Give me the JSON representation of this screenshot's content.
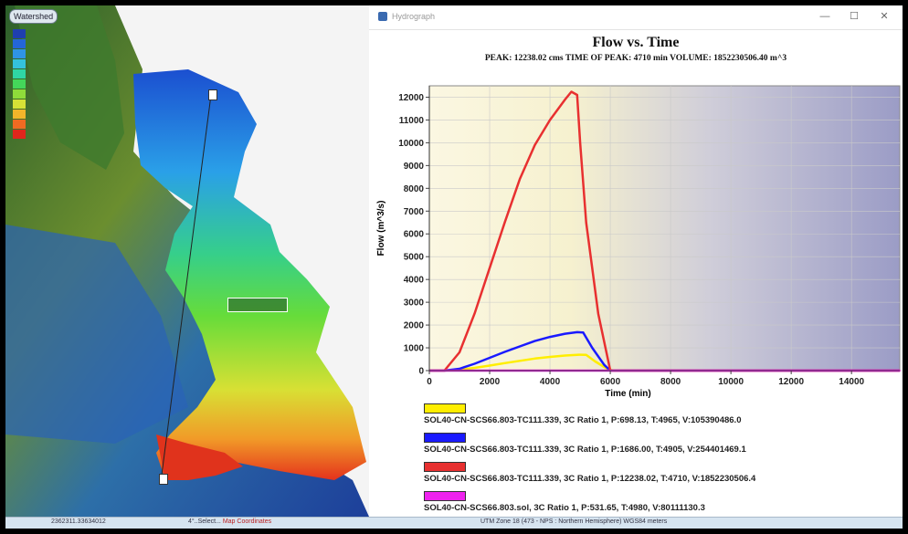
{
  "map": {
    "title": "Watershed",
    "legend": [
      {
        "label": "",
        "color": "#1f3fb0"
      },
      {
        "label": "",
        "color": "#2466d8"
      },
      {
        "label": "",
        "color": "#2f94e6"
      },
      {
        "label": "",
        "color": "#34c2dc"
      },
      {
        "label": "",
        "color": "#2fd6a4"
      },
      {
        "label": "",
        "color": "#44d65a"
      },
      {
        "label": "",
        "color": "#8fdc3a"
      },
      {
        "label": "",
        "color": "#d6e236"
      },
      {
        "label": "",
        "color": "#f2b52a"
      },
      {
        "label": "",
        "color": "#ef6a22"
      },
      {
        "label": "",
        "color": "#e0261c"
      }
    ],
    "basin_label": "",
    "markers": [
      {
        "label": ""
      },
      {
        "label": ""
      }
    ]
  },
  "window": {
    "title": "Hydrograph",
    "minimize": "—",
    "maximize": "☐",
    "close": "✕"
  },
  "chart_data": {
    "type": "line",
    "title": "Flow vs. Time",
    "subtitle": "PEAK: 12238.02 cms   TIME OF PEAK: 4710 min   VOLUME: 1852230506.40 m^3",
    "xlabel": "Time (min)",
    "ylabel": "Flow (m^3/s)",
    "xlim": [
      0,
      15600
    ],
    "ylim": [
      0,
      12500
    ],
    "xticks": [
      0,
      2000,
      4000,
      6000,
      8000,
      10000,
      12000,
      14000
    ],
    "yticks": [
      0,
      1000,
      2000,
      3000,
      4000,
      5000,
      6000,
      7000,
      8000,
      9000,
      10000,
      11000,
      12000
    ],
    "series": [
      {
        "name": "SOL40-CN-SCS66.803-TC111.339, 3C Ratio 1, P:698.13, T:4965, V:105390486.0",
        "color": "#ffee00",
        "x": [
          0,
          500,
          1000,
          1500,
          2000,
          2500,
          3000,
          3500,
          4000,
          4500,
          4965,
          5200,
          5500,
          5900,
          6100,
          15600
        ],
        "y": [
          0,
          0,
          40,
          120,
          220,
          330,
          430,
          530,
          600,
          660,
          698,
          690,
          400,
          80,
          0,
          0
        ]
      },
      {
        "name": "SOL40-CN-SCS66.803-TC111.339, 3C Ratio 1, P:1686.00, T:4905, V:254401469.1",
        "color": "#1a1aff",
        "x": [
          0,
          500,
          1000,
          1500,
          2000,
          2500,
          3000,
          3500,
          4000,
          4500,
          4905,
          5100,
          5400,
          5800,
          6000,
          15600
        ],
        "y": [
          0,
          0,
          80,
          300,
          560,
          820,
          1060,
          1300,
          1480,
          1620,
          1686,
          1670,
          1000,
          250,
          0,
          0
        ]
      },
      {
        "name": "SOL40-CN-SCS66.803-TC111.339, 3C Ratio 1, P:12238.02, T:4710, V:1852230506.4",
        "color": "#e83030",
        "x": [
          0,
          500,
          1000,
          1500,
          2000,
          2500,
          3000,
          3500,
          4000,
          4500,
          4710,
          4900,
          5000,
          5200,
          5600,
          6000,
          15600
        ],
        "y": [
          0,
          0,
          800,
          2500,
          4500,
          6500,
          8400,
          9900,
          11000,
          11900,
          12238,
          12100,
          10000,
          6500,
          2500,
          0,
          0
        ]
      },
      {
        "name": "SOL40-CN-SCS66.803.sol, 3C Ratio 1, P:531.65, T:4980, V:80111130.3",
        "color": "#ee22ee",
        "x": [
          0,
          15600
        ],
        "y": [
          0,
          0
        ]
      }
    ]
  },
  "statusbar": {
    "left": "2362311.33634012",
    "middle": "4°..Select...",
    "middle_link": "Map Coordinates",
    "right": "UTM Zone 18 (473 - NPS : Northern Hemisphere) WGS84 meters"
  }
}
